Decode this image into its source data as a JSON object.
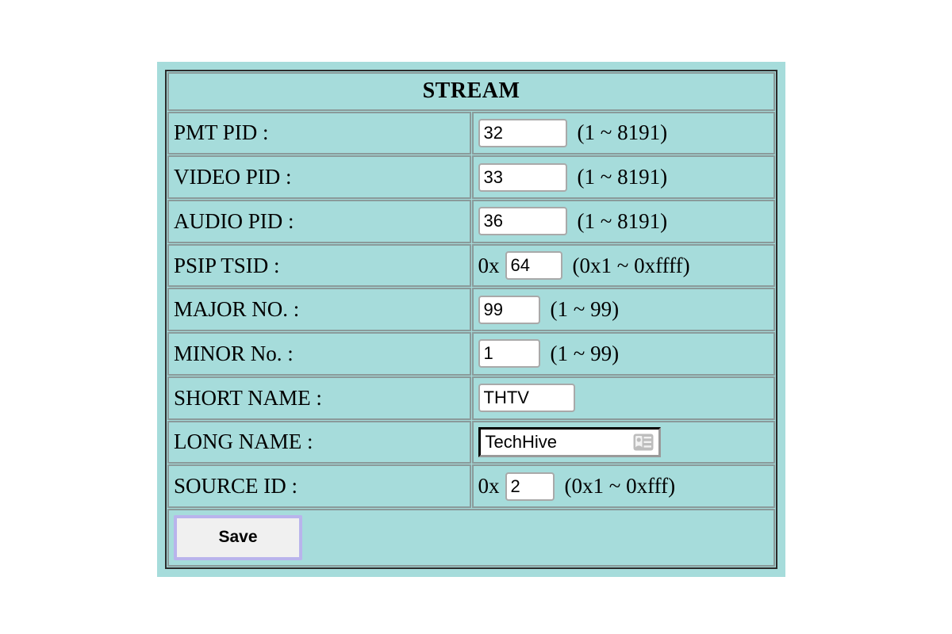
{
  "panel": {
    "header_title": "STREAM",
    "background_color": "#a6dcdb",
    "border_color": "#2b2b2b",
    "cell_border_color": "#8a9a9a"
  },
  "rows": [
    {
      "label": "PMT PID :",
      "prefix": "",
      "value": "32",
      "hint": "(1 ~ 8191)"
    },
    {
      "label": "VIDEO PID :",
      "prefix": "",
      "value": "33",
      "hint": "(1 ~ 8191)"
    },
    {
      "label": "AUDIO PID :",
      "prefix": "",
      "value": "36",
      "hint": "(1 ~ 8191)"
    },
    {
      "label": "PSIP TSID :",
      "prefix": "0x",
      "value": "64",
      "hint": "(0x1 ~ 0xffff)"
    },
    {
      "label": "MAJOR NO. :",
      "prefix": "",
      "value": "99",
      "hint": "(1 ~ 99)"
    },
    {
      "label": "MINOR No. :",
      "prefix": "",
      "value": "1",
      "hint": "(1 ~ 99)"
    },
    {
      "label": "SHORT NAME :",
      "prefix": "",
      "value": "THTV",
      "hint": ""
    },
    {
      "label": "LONG NAME :",
      "prefix": "",
      "value": "TechHive",
      "hint": "",
      "icon": "contact-card-icon",
      "focused": true
    },
    {
      "label": "SOURCE ID :",
      "prefix": "0x",
      "value": "2",
      "hint": "(0x1 ~ 0xfff)"
    }
  ],
  "actions": {
    "save_label": "Save",
    "save_focus_ring_color": "#b9b4ec",
    "save_background_color": "#f0f0f0"
  }
}
